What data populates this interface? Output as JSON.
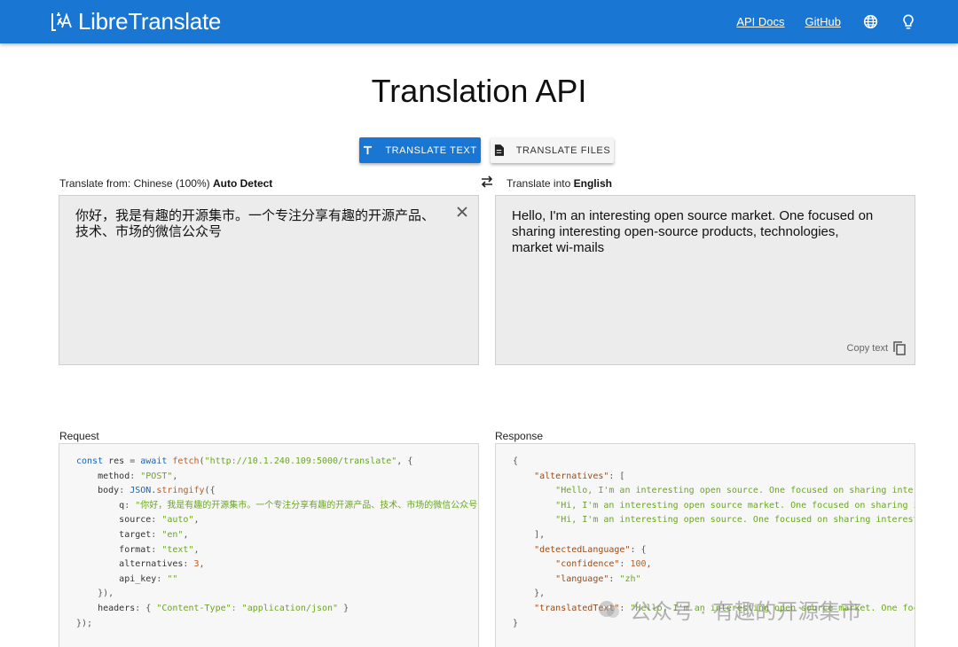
{
  "header": {
    "brand": "LibreTranslate",
    "nav": {
      "api_docs": "API Docs",
      "github": "GitHub"
    },
    "icons": [
      "globe-icon",
      "lightbulb-icon"
    ],
    "color": "#1976d2"
  },
  "page": {
    "title": "Translation API"
  },
  "modes": {
    "text": "TRANSLATE TEXT",
    "files": "TRANSLATE FILES"
  },
  "source": {
    "prefix": "Translate from: Chinese (100%)",
    "detect": "Auto Detect",
    "text": "你好，我是有趣的开源集市。一个专注分享有趣的开源产品、技术、市场的微信公众号"
  },
  "target": {
    "prefix": "Translate into",
    "language": "English",
    "text": "Hello, I'm an interesting open source market. One focused on sharing interesting open-source products, technologies, market wi-mails",
    "copy_label": "Copy text"
  },
  "request": {
    "label": "Request",
    "url": "\"http://10.1.240.109:5000/translate\"",
    "method": "\"POST\"",
    "q": "\"你好，我是有趣的开源集市。一个专注分享有趣的开源产品、技术、市场的微信公众号\"",
    "source": "\"auto\"",
    "target": "\"en\"",
    "format": "\"text\"",
    "alternatives": "3",
    "api_key": "\"\"",
    "headers": "\"Content-Type\": \"application/json\""
  },
  "response": {
    "label": "Response",
    "alt1": "\"Hello, I'm an interesting open source. One focused on sharing interesting open-source products\",",
    "alt2": "\"Hi, I'm an interesting open source market. One focused on sharing interesting open-source\",",
    "alt3": "\"Hi, I'm an interesting open source. One focused on sharing interesting open-source products\"",
    "confidence": "100",
    "language": "\"zh\"",
    "translated": "\"Hello, I'm an interesting open source market. One focused on sharing interesting open-source products\""
  },
  "watermark": "公众号 · 有趣的开源集市"
}
